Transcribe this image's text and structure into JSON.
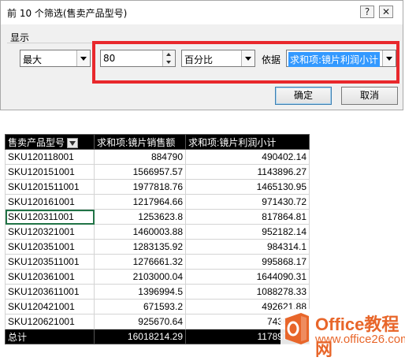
{
  "dialog": {
    "title": "前 10 个筛选(售卖产品型号)",
    "help": "?",
    "close": "✕",
    "group_label": "显示",
    "mode_value": "最大",
    "count_value": "80",
    "unit_value": "百分比",
    "by_label": "依据",
    "field_value": "求和项:镜片利润小计",
    "ok_label": "确定",
    "cancel_label": "取消",
    "highlight_color": "#e8282c"
  },
  "table": {
    "headers": [
      "售卖产品型号",
      "求和项:镜片销售额",
      "求和项:镜片利润小计"
    ],
    "rows": [
      [
        "SKU120118001",
        "884790",
        "490402.14"
      ],
      [
        "SKU120151001",
        "1566957.57",
        "1143896.27"
      ],
      [
        "SKU1201511001",
        "1977818.76",
        "1465130.95"
      ],
      [
        "SKU120161001",
        "1217964.66",
        "971430.72"
      ],
      [
        "SKU120311001",
        "1253623.8",
        "817864.81"
      ],
      [
        "SKU120321001",
        "1460003.88",
        "952182.14"
      ],
      [
        "SKU120351001",
        "1283135.92",
        "984314.1"
      ],
      [
        "SKU1203511001",
        "1276661.32",
        "995868.17"
      ],
      [
        "SKU120361001",
        "2103000.04",
        "1644090.31"
      ],
      [
        "SKU1203611001",
        "1396994.5",
        "1088278.33"
      ],
      [
        "SKU120421001",
        "671593.2",
        "492621.88"
      ],
      [
        "SKU120621001",
        "925670.64",
        "743674.1"
      ]
    ],
    "total": [
      "总计",
      "16018214.29",
      "11789753.9"
    ]
  },
  "watermark": {
    "line1": "Office教程网",
    "line2": "www.office26.com",
    "color": "#e8662a"
  }
}
